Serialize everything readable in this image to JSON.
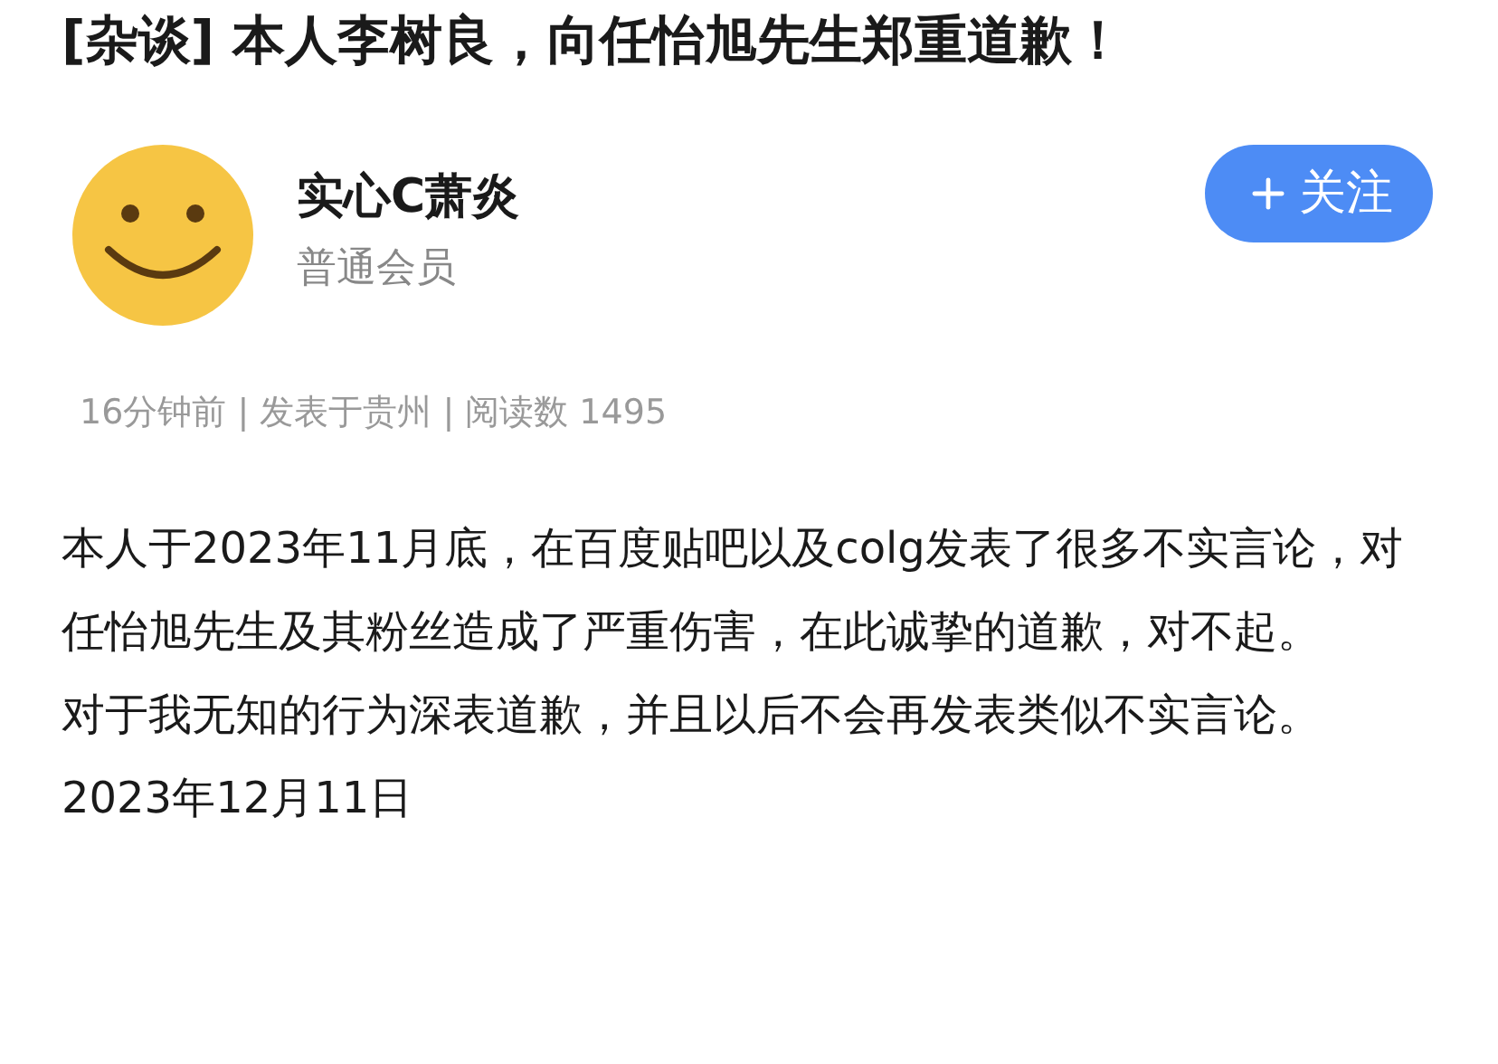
{
  "title": "[杂谈] 本人李树良，向任怡旭先生郑重道歉！",
  "author": {
    "name": "实心C萧炎",
    "role": "普通会员"
  },
  "follow_button": {
    "label": "关注"
  },
  "meta": "16分钟前 | 发表于贵州 | 阅读数 1495",
  "body": [
    "本人于2023年11月底，在百度贴吧以及colg发表了很多不实言论，对任怡旭先生及其粉丝造成了严重伤害，在此诚挚的道歉，对不起。",
    "对于我无知的行为深表道歉，并且以后不会再发表类似不实言论。",
    "2023年12月11日"
  ]
}
